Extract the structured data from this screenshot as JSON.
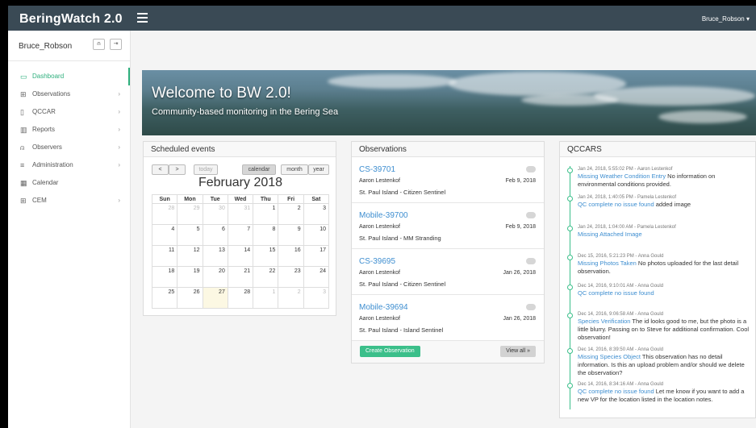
{
  "app": {
    "brand": "BeringWatch 2.0",
    "top_user": "Bruce_Robson ▾"
  },
  "sidebar": {
    "username": "Bruce_Robson",
    "items": [
      {
        "label": "Dashboard",
        "icon": "monitor-icon",
        "glyph": "▭",
        "chevron": false
      },
      {
        "label": "Observations",
        "icon": "binoculars-icon",
        "glyph": "⊞",
        "chevron": true
      },
      {
        "label": "QCCAR",
        "icon": "clipboard-icon",
        "glyph": "▯",
        "chevron": true
      },
      {
        "label": "Reports",
        "icon": "bar-chart-icon",
        "glyph": "▥",
        "chevron": true
      },
      {
        "label": "Observers",
        "icon": "user-icon",
        "glyph": "⍝",
        "chevron": true
      },
      {
        "label": "Administration",
        "icon": "menu-icon",
        "glyph": "≡",
        "chevron": true
      },
      {
        "label": "Calendar",
        "icon": "calendar-icon",
        "glyph": "▦",
        "chevron": false
      },
      {
        "label": "CEM",
        "icon": "binoculars-icon",
        "glyph": "⊞",
        "chevron": true
      }
    ],
    "chevron": "›"
  },
  "hero": {
    "title": "Welcome to BW 2.0!",
    "subtitle": "Community-based monitoring in the Bering Sea"
  },
  "calendar": {
    "panel_title": "Scheduled events",
    "prev": "<",
    "next": ">",
    "today": "today",
    "views": [
      "calendar",
      "month",
      "year"
    ],
    "month_title": "February 2018",
    "weekdays": [
      "Sun",
      "Mon",
      "Tue",
      "Wed",
      "Thu",
      "Fri",
      "Sat"
    ],
    "weeks": [
      [
        {
          "d": "28",
          "o": true
        },
        {
          "d": "29",
          "o": true
        },
        {
          "d": "30",
          "o": true
        },
        {
          "d": "31",
          "o": true
        },
        {
          "d": "1"
        },
        {
          "d": "2"
        },
        {
          "d": "3"
        }
      ],
      [
        {
          "d": "4"
        },
        {
          "d": "5"
        },
        {
          "d": "6"
        },
        {
          "d": "7"
        },
        {
          "d": "8"
        },
        {
          "d": "9"
        },
        {
          "d": "10"
        }
      ],
      [
        {
          "d": "11"
        },
        {
          "d": "12"
        },
        {
          "d": "13"
        },
        {
          "d": "14"
        },
        {
          "d": "15"
        },
        {
          "d": "16"
        },
        {
          "d": "17"
        }
      ],
      [
        {
          "d": "18"
        },
        {
          "d": "19"
        },
        {
          "d": "20"
        },
        {
          "d": "21"
        },
        {
          "d": "22"
        },
        {
          "d": "23"
        },
        {
          "d": "24"
        }
      ],
      [
        {
          "d": "25"
        },
        {
          "d": "26"
        },
        {
          "d": "27",
          "t": true
        },
        {
          "d": "28"
        },
        {
          "d": "1",
          "o": true
        },
        {
          "d": "2",
          "o": true
        },
        {
          "d": "3",
          "o": true
        }
      ]
    ]
  },
  "observations": {
    "panel_title": "Observations",
    "items": [
      {
        "id": "CS-39701",
        "user": "Aaron Lestenkof",
        "date": "Feb 9, 2018",
        "location": "St. Paul Island - Citizen Sentinel"
      },
      {
        "id": "Mobile-39700",
        "user": "Aaron Lestenkof",
        "date": "Feb 9, 2018",
        "location": "St. Paul Island - MM Stranding"
      },
      {
        "id": "CS-39695",
        "user": "Aaron Lestenkof",
        "date": "Jan 26, 2018",
        "location": "St. Paul Island - Citizen Sentinel"
      },
      {
        "id": "Mobile-39694",
        "user": "Aaron Lestenkof",
        "date": "Jan 26, 2018",
        "location": "St. Paul Island - Island Sentinel"
      }
    ],
    "create_label": "Create Observation",
    "view_all_label": "View all »"
  },
  "qccars": {
    "panel_title": "QCCARS",
    "entries": [
      {
        "meta": "Jan 24, 2018, 5:55:02 PM - Aaron Lestenkof",
        "link": "Missing Weather Condition Entry",
        "text": " No information on environmental conditions provided."
      },
      {
        "meta": "Jan 24, 2018, 1:40:05 PM - Pamela Lestenkof",
        "link": "QC complete no issue found",
        "text": " added image"
      },
      {
        "meta": "Jan 24, 2018, 1:04:00 AM - Pamela Lestenkof",
        "link": "Missing Attached Image",
        "text": ""
      },
      {
        "meta": "Dec 15, 2016, 5:21:23 PM - Anna Gould",
        "link": "Missing Photos Taken",
        "text": " No photos uploaded for the last detail observation."
      },
      {
        "meta": "Dec 14, 2016, 9:10:01 AM - Anna Gould",
        "link": "QC complete no issue found",
        "text": ""
      },
      {
        "meta": "Dec 14, 2016, 9:06:58 AM - Anna Gould",
        "link": "Species Verification",
        "text": " The id looks good to me, but the photo is a little blurry. Passing on to Steve for additional confirmation. Cool observation!"
      },
      {
        "meta": "Dec 14, 2016, 8:39:50 AM - Anna Gould",
        "link": "Missing Species Object",
        "text": " This observation has no detail information. Is this an upload problem and/or should we delete the observation?"
      },
      {
        "meta": "Dec 14, 2016, 8:34:16 AM - Anna Gould",
        "link": "QC complete no issue found",
        "text": " Let me know if you want to add a new VP for the location listed in the location notes."
      }
    ]
  },
  "colors": {
    "accent": "#3bbf8a",
    "link": "#3e8ed0",
    "topbar": "#3a4a55"
  }
}
